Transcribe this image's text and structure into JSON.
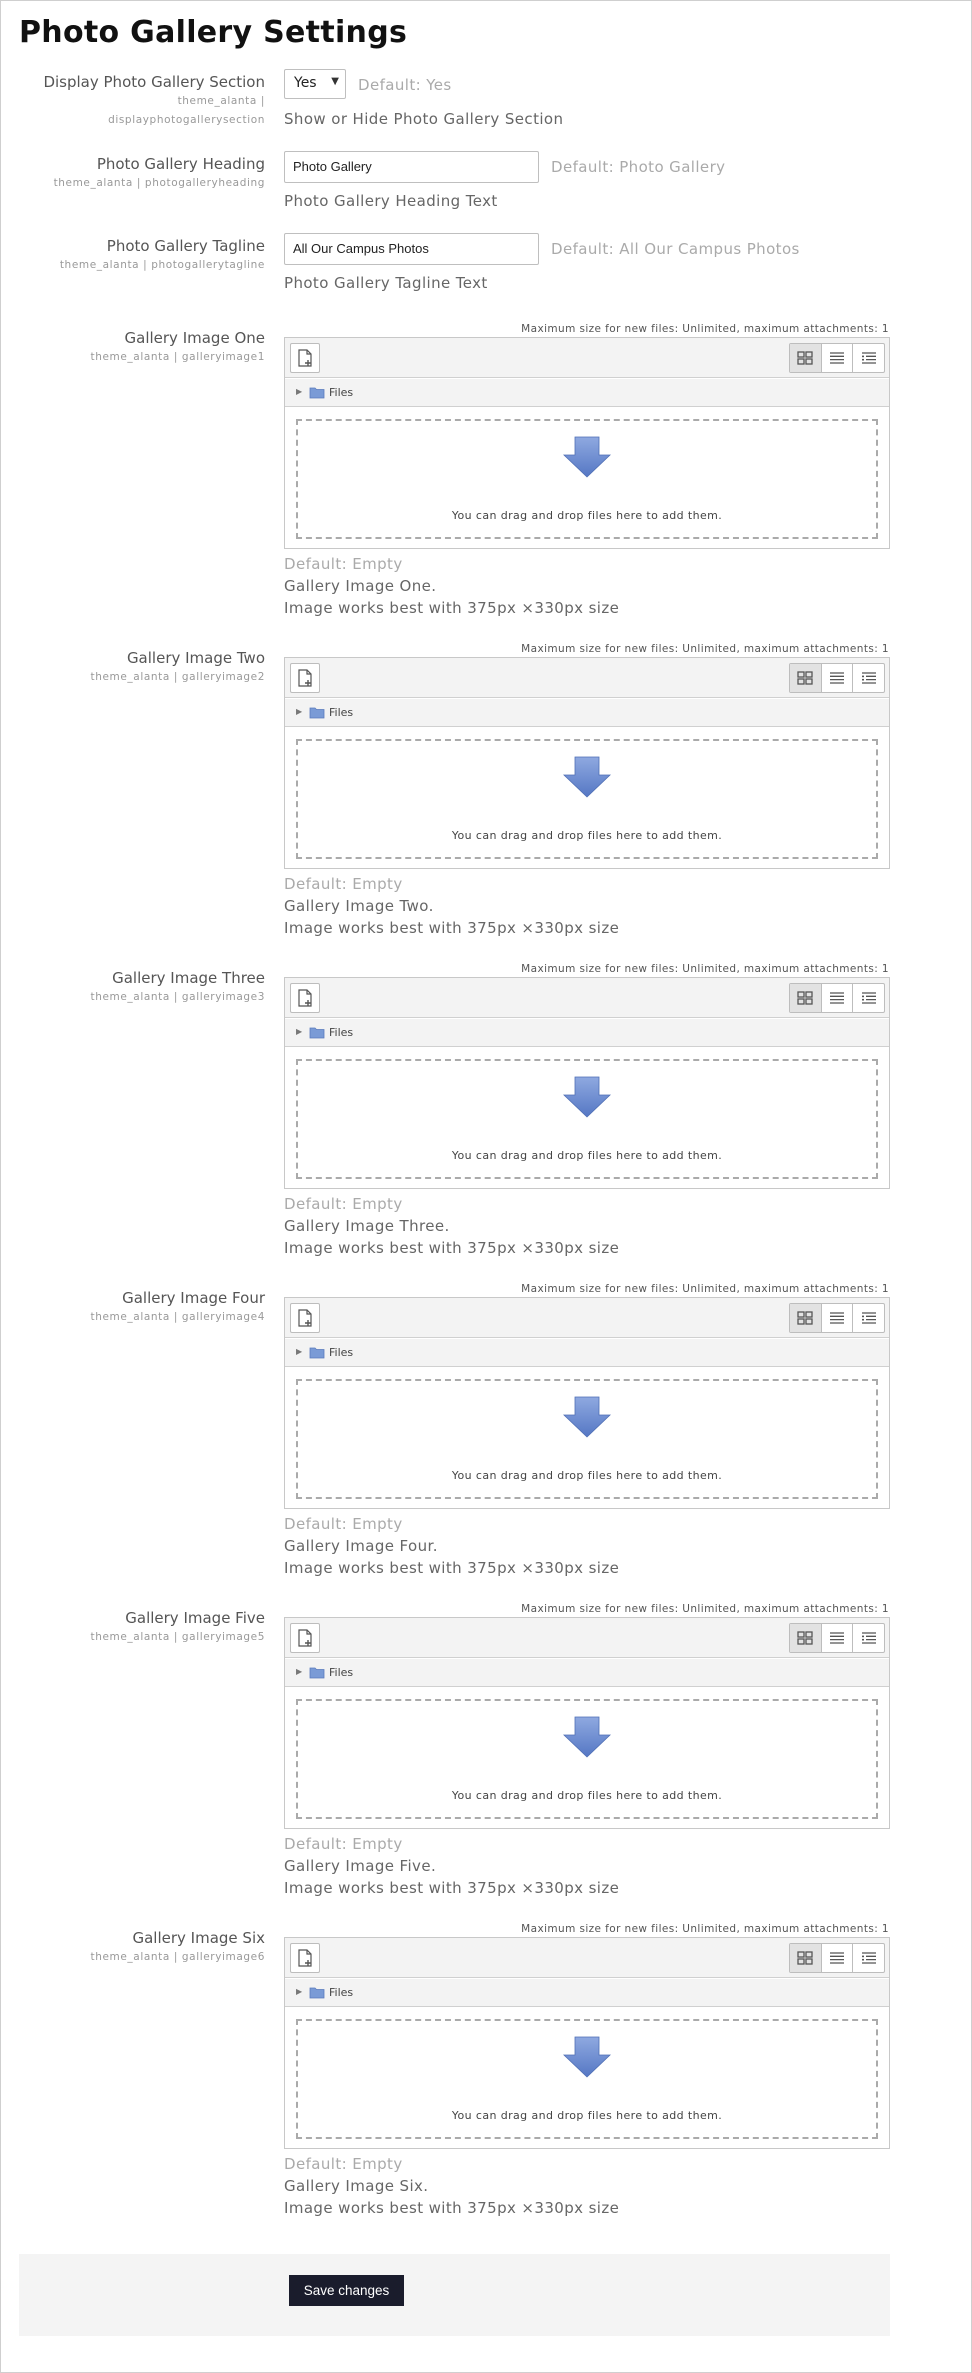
{
  "page": {
    "title": "Photo Gallery Settings"
  },
  "settings": {
    "display": {
      "label": "Display Photo Gallery Section",
      "key_line1": "theme_alanta |",
      "key_line2": "displayphotogallerysection",
      "value": "Yes",
      "default": "Default: Yes",
      "description": "Show or Hide Photo Gallery Section"
    },
    "heading": {
      "label": "Photo Gallery Heading",
      "key": "theme_alanta | photogalleryheading",
      "value": "Photo Gallery",
      "default": "Default: Photo Gallery",
      "description": "Photo Gallery Heading Text"
    },
    "tagline": {
      "label": "Photo Gallery Tagline",
      "key": "theme_alanta | photogallerytagline",
      "value": "All Our Campus Photos",
      "default": "Default: All Our Campus Photos",
      "description": "Photo Gallery Tagline Text"
    }
  },
  "filepicker": {
    "limit": "Maximum size for new files: Unlimited, maximum attachments: 1",
    "path_label": "Files",
    "drop_text": "You can drag and drop files here to add them.",
    "default": "Default: Empty",
    "size_hint": "Image works best with 375px ×330px size"
  },
  "images": [
    {
      "label": "Gallery Image One",
      "key": "theme_alanta | galleryimage1",
      "description": "Gallery Image One."
    },
    {
      "label": "Gallery Image Two",
      "key": "theme_alanta | galleryimage2",
      "description": "Gallery Image Two."
    },
    {
      "label": "Gallery Image Three",
      "key": "theme_alanta | galleryimage3",
      "description": "Gallery Image Three."
    },
    {
      "label": "Gallery Image Four",
      "key": "theme_alanta | galleryimage4",
      "description": "Gallery Image Four."
    },
    {
      "label": "Gallery Image Five",
      "key": "theme_alanta | galleryimage5",
      "description": "Gallery Image Five."
    },
    {
      "label": "Gallery Image Six",
      "key": "theme_alanta | galleryimage6",
      "description": "Gallery Image Six."
    }
  ],
  "footer": {
    "save_label": "Save changes"
  },
  "colors": {
    "button_bg": "#1a1c2c",
    "arrow": "#6f8fd1",
    "folder": "#7a9bd6"
  }
}
